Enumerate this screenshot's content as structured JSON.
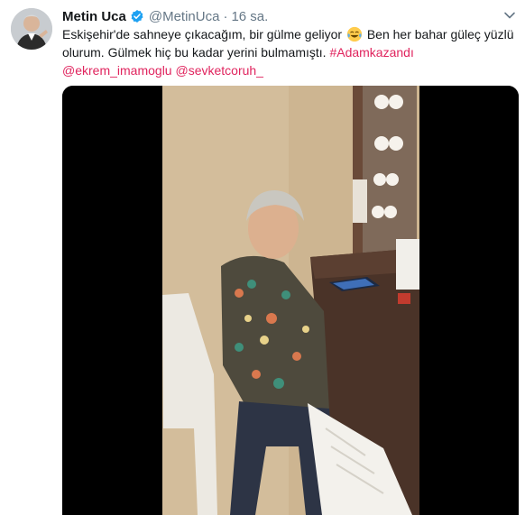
{
  "tweet": {
    "author_name": "Metin Uca",
    "author_handle": "@MetinUca",
    "separator": "·",
    "time": "16 sa.",
    "text_parts": {
      "line1": "Eskişehir'de sahneye çıkacağım, bir gülme geliyor",
      "emoji": "face-with-tears-of-joy",
      "line1b": " Ben her bahar güleç yüzlü olurum. Gülmek hiç bu kadar yerini bulmamıştı. ",
      "hashtag": "#Adamkazandı",
      "mention1": "@ekrem_imamoglu",
      "mention2": "@sevketcoruh_"
    },
    "link_color": "#e0245e"
  },
  "icons": {
    "verified": "verified-badge-icon",
    "menu": "chevron-down-icon"
  },
  "media": {
    "kind": "video",
    "description_visible": false
  }
}
